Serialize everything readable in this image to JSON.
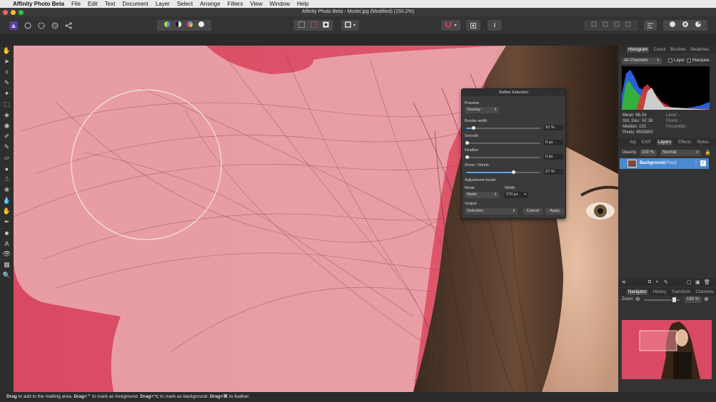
{
  "menubar": {
    "apple": "",
    "app_name": "Affinity Photo Beta",
    "items": [
      "File",
      "Edit",
      "Text",
      "Document",
      "Layer",
      "Select",
      "Arrange",
      "Filters",
      "View",
      "Window",
      "Help"
    ]
  },
  "window": {
    "title": "Affinity Photo Beta - Model.jpg (Modified) (150.2%)"
  },
  "colors": {
    "accent": "#5aa0e6",
    "overlay": "#e06b7e",
    "canvas_bg": "#1b1b1b"
  },
  "refine": {
    "title": "Refine Selection",
    "preview_label": "Preview",
    "preview_value": "Overlay",
    "border_label": "Border width",
    "border_value": "10 %",
    "border_level": 0.1,
    "smooth_label": "Smooth",
    "smooth_value": "0 px",
    "feather_label": "Feather",
    "feather_value": "0 px",
    "grow_label": "Grow / Shrink",
    "grow_value": "27 %",
    "grow_level": 0.6,
    "brush_label": "Adjustment brush",
    "mode_label": "Mode",
    "mode_value": "Matte",
    "width_label": "Width",
    "width_value": "270 px",
    "output_label": "Output",
    "output_value": "Selection",
    "cancel": "Cancel",
    "apply": "Apply"
  },
  "histogram": {
    "tabs": [
      "Histogram",
      "Colour",
      "Brushes",
      "Swatches"
    ],
    "channel": "All Channels",
    "layer_label": "Layer",
    "marquee_label": "Marquee",
    "mean": "Mean: 86.04",
    "std": "Std. Dev.: 67.38",
    "median": "Median: 102",
    "pixels": "Pixels: 4505800",
    "level": "Level: -",
    "pixels2": "Pixels: -",
    "percentile": "Percentile: -"
  },
  "layers": {
    "tabs": [
      "Adj",
      "EXIF",
      "Layers",
      "Effects",
      "Styles"
    ],
    "opacity_label": "Opacity:",
    "opacity_value": "100 %",
    "blend": "Normal",
    "layer_name": "Background",
    "layer_type": "(Pixel)"
  },
  "navigator": {
    "tabs": [
      "Navigator",
      "History",
      "Transform",
      "Channels"
    ],
    "zoom_label": "Zoom:",
    "zoom_value": "150 %",
    "zoom_level": 0.8
  },
  "status": {
    "segments": [
      {
        "bold": "Drag",
        "text": " to add to the matting area. "
      },
      {
        "bold": "Drag+⌃",
        "text": " to mark as foreground. "
      },
      {
        "bold": "Drag+⌥",
        "text": " to mark as background. "
      },
      {
        "bold": "Drag+⌘",
        "text": " to feather."
      }
    ]
  }
}
